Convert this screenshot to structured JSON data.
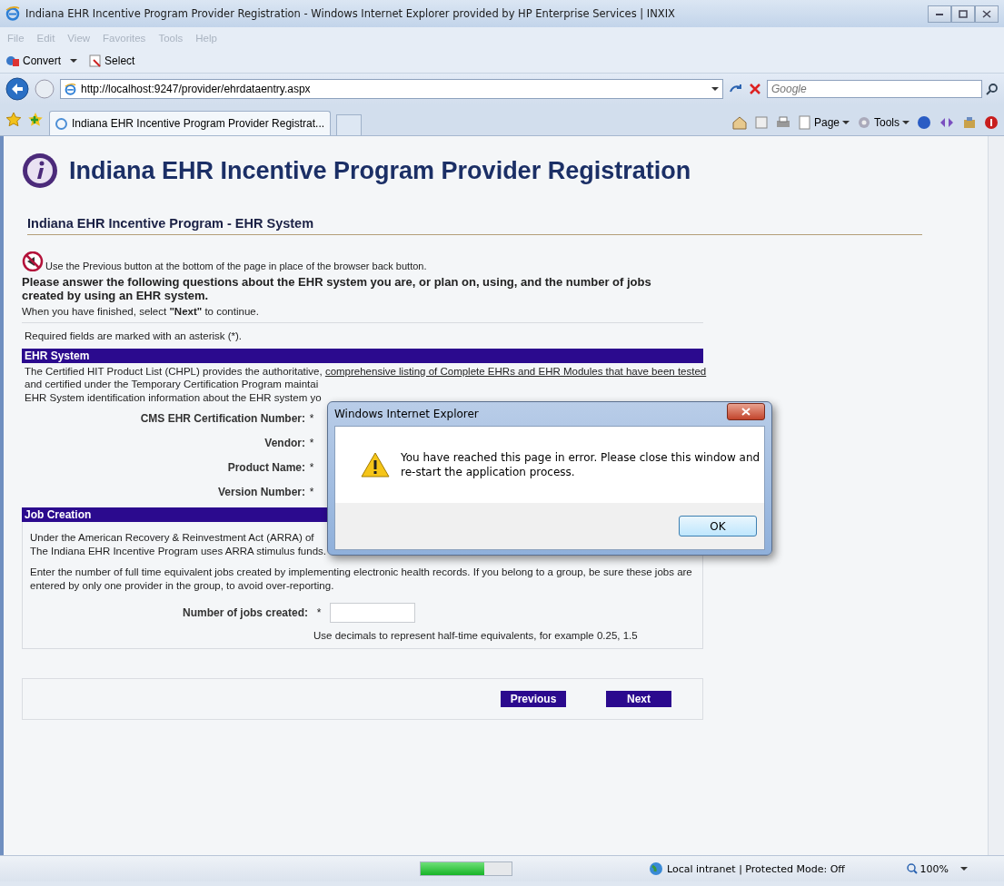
{
  "window": {
    "title": "Indiana EHR Incentive Program Provider Registration - Windows Internet Explorer provided by HP Enterprise Services | INXIX"
  },
  "menu": [
    "File",
    "Edit",
    "View",
    "Favorites",
    "Tools",
    "Help"
  ],
  "toolbar": [
    {
      "label": "Convert"
    },
    {
      "label": "Select"
    }
  ],
  "address": {
    "url": "http://localhost:9247/provider/ehrdataentry.aspx"
  },
  "search": {
    "placeholder": "Google"
  },
  "tabs": [
    {
      "label": "Indiana EHR Incentive Program Provider Registrat...",
      "selected": true
    }
  ],
  "command_bar": [
    "Page",
    "Tools"
  ],
  "page": {
    "heading": "Indiana EHR Incentive Program Provider Registration",
    "section_title": "Indiana EHR Incentive Program - EHR System",
    "notice": "Use the Previous button at the bottom of the page in place of the browser back button.",
    "intro": "Please answer the following questions about the EHR system you are, or plan on, using, and the number of jobs created by using an EHR system.",
    "finish": "When you have finished, select **\"Next\"** to continue.",
    "required_note": "Required fields are marked with an asterisk (*).",
    "ehr_system": {
      "title": "EHR System",
      "lines": [
        {
          "text": "The Certified HIT Product List (CHPL) provides the authoritative, ",
          "link": "comprehensive listing of Complete EHRs and EHR Modules that have been tested"
        },
        {
          "text": "and certified under the Temporary Certification Program maintai"
        },
        {
          "text": "EHR System identification information about the EHR system yo"
        }
      ],
      "fields": [
        {
          "label": "CMS EHR Certification Number:",
          "marker": "*"
        },
        {
          "label": "Vendor:",
          "marker": "*"
        },
        {
          "label": "Product Name:",
          "marker": "*"
        },
        {
          "label": "Version Number:",
          "marker": "*"
        }
      ]
    },
    "job_creation": {
      "title": "Job Creation",
      "paragraphs": [
        "Under the American Recovery & Reinvestment Act (ARRA) of\nThe Indiana EHR Incentive Program uses ARRA stimulus funds.",
        "Enter the number of full time equivalent jobs created by implementing electronic health records. If you belong to a group, be sure these jobs are entered by only one provider in the group, to avoid over-reporting."
      ],
      "field": {
        "label": "Number of jobs created:",
        "marker": "*"
      },
      "hint": "Use decimals to represent half-time equivalents, for example 0.25, 1.5"
    },
    "buttons": [
      "Previous",
      "Next"
    ]
  },
  "dialog": {
    "title": "Windows Internet Explorer",
    "message": "You have reached this page in error.  Please close this window and re-start the application process.",
    "button": "OK"
  },
  "status_bar": {
    "zone": "Local intranet | Protected Mode: Off",
    "zoom": "100%",
    "progress": {
      "level": 0.7
    }
  }
}
